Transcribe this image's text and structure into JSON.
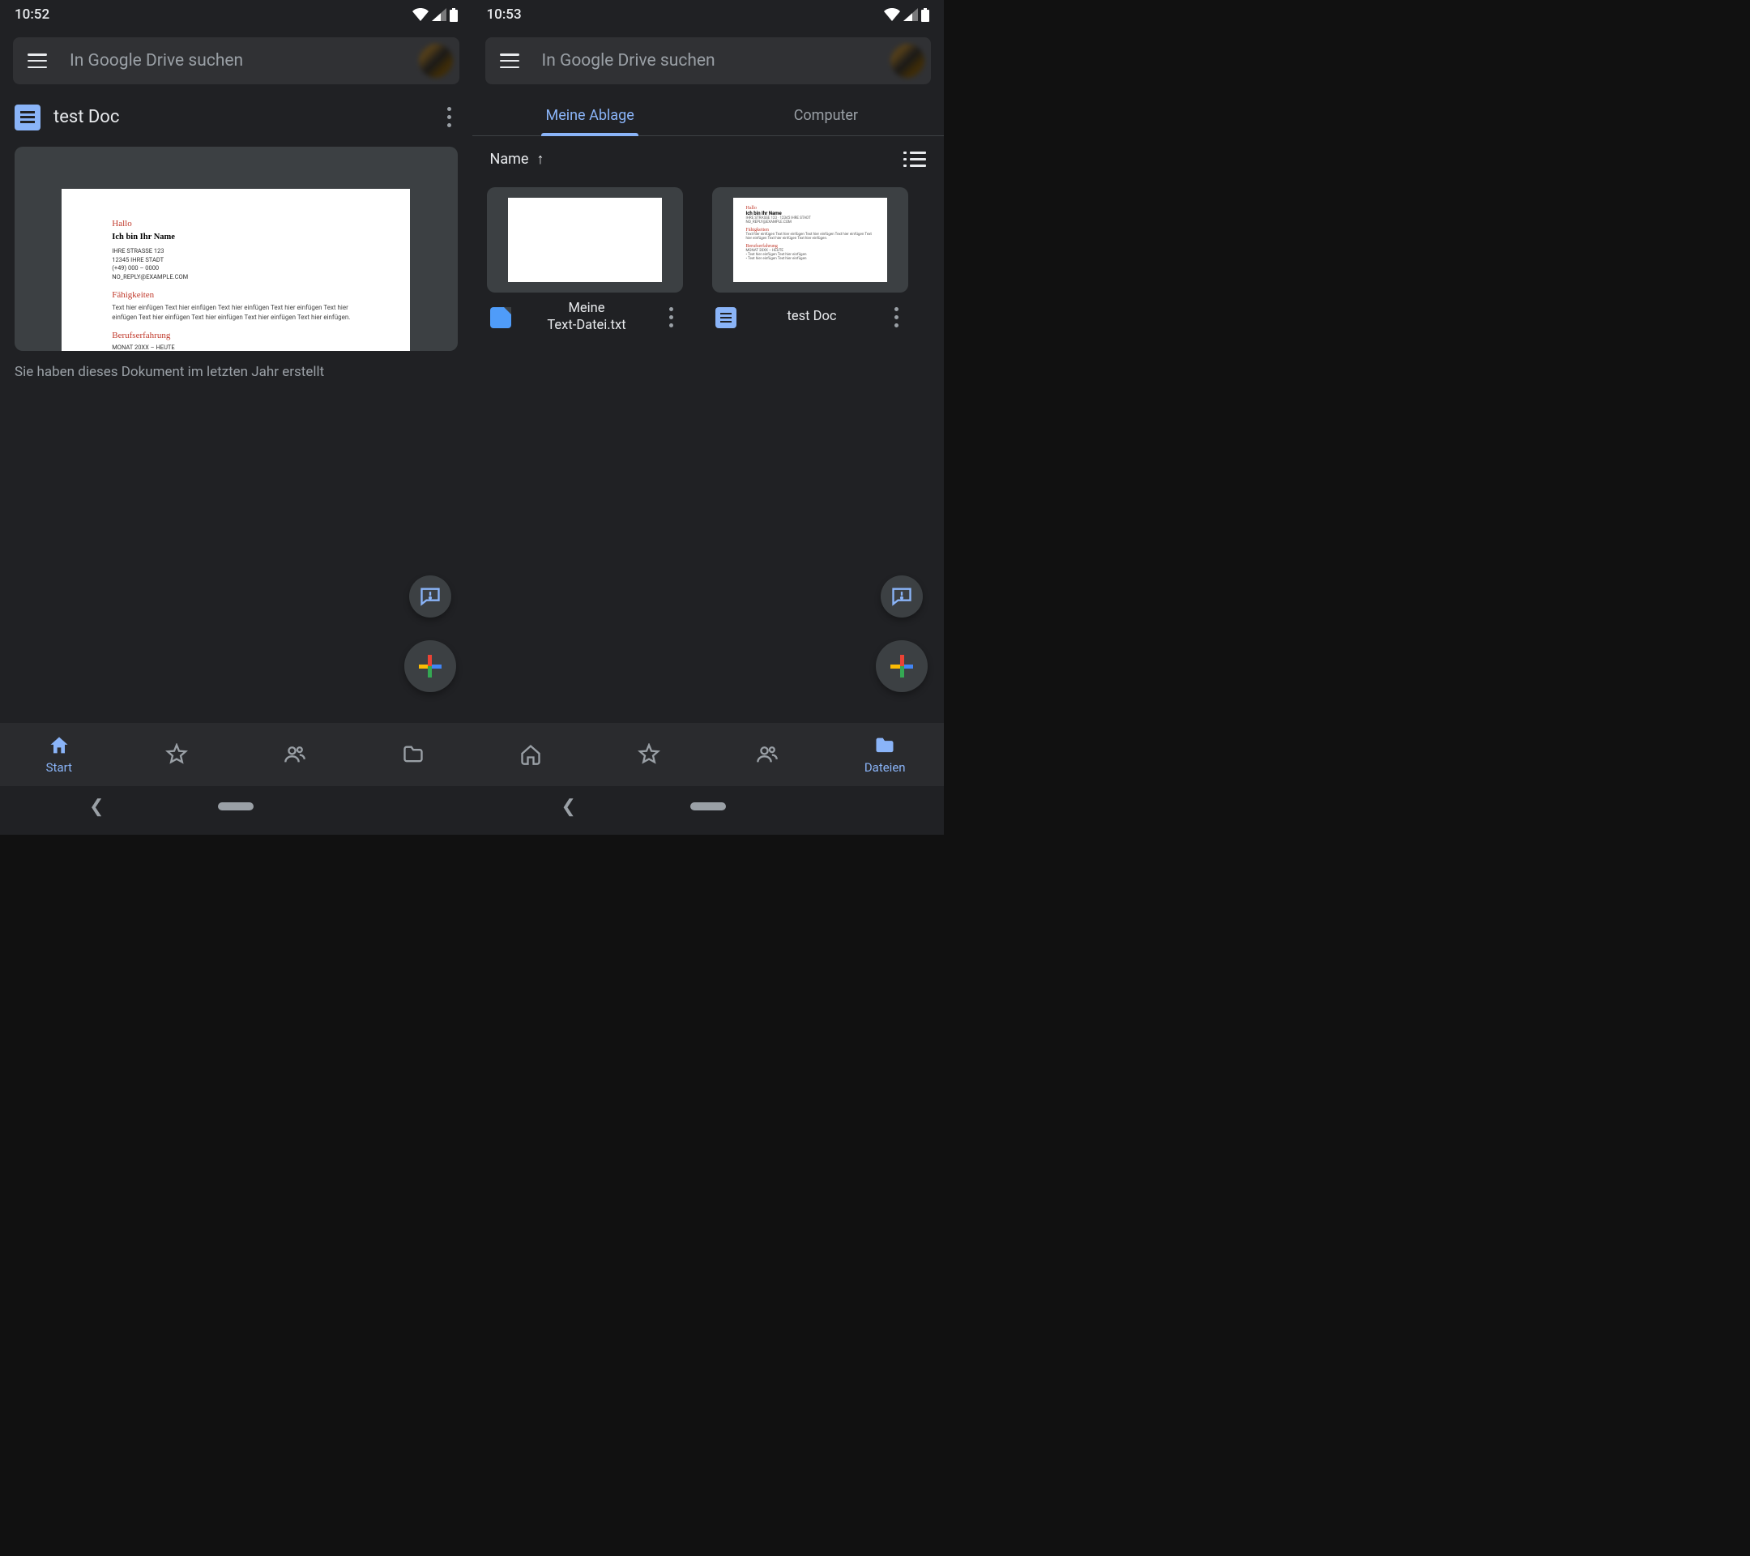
{
  "left": {
    "status_time": "10:52",
    "search_placeholder": "In Google Drive suchen",
    "suggestion": {
      "title": "test Doc",
      "caption": "Sie haben dieses Dokument im letzten Jahr erstellt",
      "page": {
        "hallo": "Hallo",
        "name_line": "Ich bin Ihr Name",
        "addr1": "IHRE STRASSE 123",
        "addr2": "12345 IHRE STADT",
        "phone": "(+49) 000 – 0000",
        "email": "NO_REPLY@EXAMPLE.COM",
        "sec2": "Fähigkeiten",
        "lorem": "Text hier einfügen Text hier einfügen Text hier einfügen Text hier einfügen Text hier einfügen Text hier einfügen Text hier einfügen Text hier einfügen Text hier einfügen.",
        "sec3": "Berufserfahrung",
        "date": "MONAT 20XX – HEUTE"
      }
    },
    "nav": {
      "start": "Start",
      "starred": "",
      "shared": "",
      "files": ""
    }
  },
  "right": {
    "status_time": "10:53",
    "search_placeholder": "In Google Drive suchen",
    "tabs": {
      "mydrive": "Meine Ablage",
      "computer": "Computer"
    },
    "sort_label": "Name",
    "files": [
      {
        "name": "Meine\nText-Datei.txt"
      },
      {
        "name": "test Doc"
      }
    ],
    "nav_files": "Dateien"
  },
  "doc_thumb": {
    "hallo": "Hallo",
    "name": "Ich bin Ihr Name",
    "sec2": "Fähigkeiten",
    "sec3": "Berufserfahrung"
  }
}
